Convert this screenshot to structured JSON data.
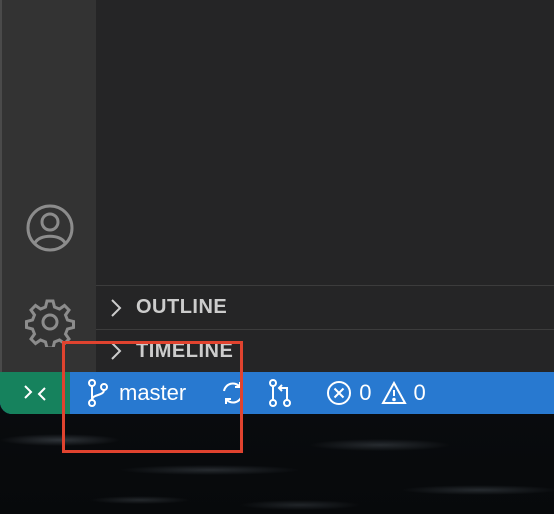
{
  "sections": {
    "outline_label": "OUTLINE",
    "timeline_label": "TIMELINE"
  },
  "status_bar": {
    "branch": "master",
    "errors": "0",
    "warnings": "0"
  },
  "icons": {
    "account": "account-icon",
    "settings": "gear-icon",
    "remote": "remote-icon",
    "branch": "source-branch-icon",
    "sync": "sync-icon",
    "pull_request": "pull-request-icon",
    "error": "error-icon",
    "warning": "warning-icon"
  },
  "colors": {
    "status_bar": "#2879d0",
    "remote_button": "#16825d",
    "activity_bar": "#333333",
    "highlight": "#e0432f"
  }
}
